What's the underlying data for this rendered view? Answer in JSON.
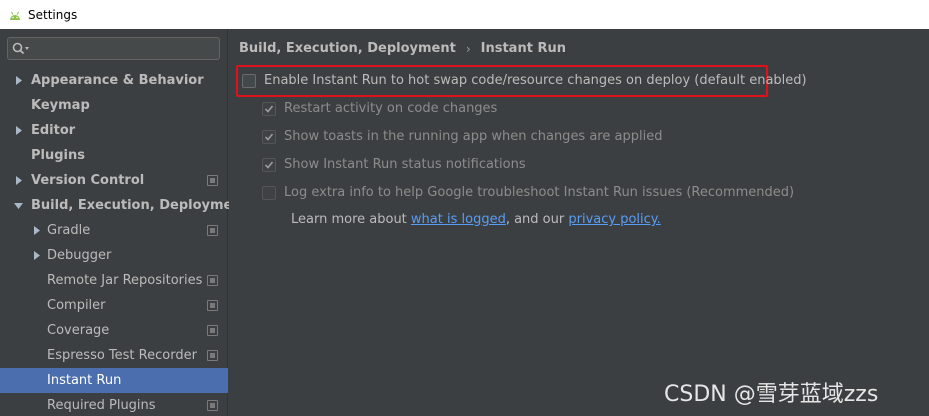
{
  "window": {
    "title": "Settings",
    "icon": "android-icon"
  },
  "search": {
    "value": "",
    "placeholder": "",
    "icon": "search-icon"
  },
  "sidebar": {
    "items": [
      {
        "label": "Appearance & Behavior",
        "bold": true,
        "arrow": "right",
        "has_project_icon": false,
        "selected": false
      },
      {
        "label": "Keymap",
        "bold": true,
        "arrow": "none",
        "has_project_icon": false,
        "selected": false
      },
      {
        "label": "Editor",
        "bold": true,
        "arrow": "right",
        "has_project_icon": false,
        "selected": false
      },
      {
        "label": "Plugins",
        "bold": true,
        "arrow": "none",
        "has_project_icon": false,
        "selected": false
      },
      {
        "label": "Version Control",
        "bold": true,
        "arrow": "right",
        "has_project_icon": true,
        "selected": false
      },
      {
        "label": "Build, Execution, Deployment",
        "bold": true,
        "arrow": "down",
        "has_project_icon": false,
        "selected": false
      },
      {
        "label": "Gradle",
        "bold": false,
        "arrow": "none",
        "has_project_icon": true,
        "selected": false
      },
      {
        "label": "Debugger",
        "bold": false,
        "arrow": "right",
        "has_project_icon": false,
        "selected": false
      },
      {
        "label": "Remote Jar Repositories",
        "bold": false,
        "arrow": "none",
        "has_project_icon": true,
        "selected": false
      },
      {
        "label": "Compiler",
        "bold": false,
        "arrow": "none",
        "has_project_icon": true,
        "selected": false
      },
      {
        "label": "Coverage",
        "bold": false,
        "arrow": "none",
        "has_project_icon": true,
        "selected": false
      },
      {
        "label": "Espresso Test Recorder",
        "bold": false,
        "arrow": "none",
        "has_project_icon": true,
        "selected": false
      },
      {
        "label": "Instant Run",
        "bold": false,
        "arrow": "none",
        "has_project_icon": false,
        "selected": true
      },
      {
        "label": "Required Plugins",
        "bold": false,
        "arrow": "none",
        "has_project_icon": true,
        "selected": false
      }
    ]
  },
  "breadcrumb": {
    "parent": "Build, Execution, Deployment",
    "separator": "›",
    "current": "Instant Run"
  },
  "options": [
    {
      "label": "Enable Instant Run to hot swap code/resource changes on deploy (default enabled)",
      "checked": false,
      "enabled": true
    },
    {
      "label": "Restart activity on code changes",
      "checked": true,
      "enabled": false
    },
    {
      "label": "Show toasts in the running app when changes are applied",
      "checked": true,
      "enabled": false
    },
    {
      "label": "Show Instant Run status notifications",
      "checked": true,
      "enabled": false
    },
    {
      "label": "Log extra info to help Google troubleshoot Instant Run issues (Recommended)",
      "checked": false,
      "enabled": false
    }
  ],
  "learn_more": {
    "prefix": "Learn more about ",
    "link1": "what is logged",
    "middle": ", and our ",
    "link2": "privacy policy."
  },
  "watermark": "CSDN @雪芽蓝域zzs",
  "colors": {
    "background": "#3c3f41",
    "selection": "#4b6eaf",
    "link": "#589df6",
    "highlight": "#e0111a"
  }
}
